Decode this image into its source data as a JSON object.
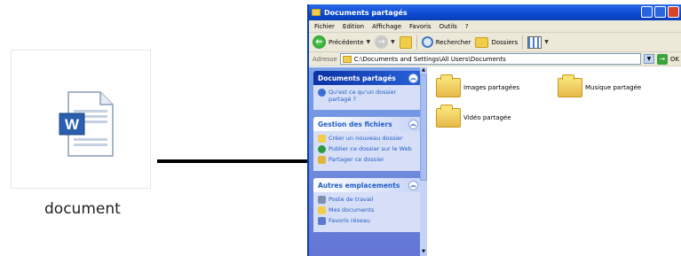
{
  "document_tile": {
    "label": "document",
    "icon": "word-document-icon"
  },
  "window": {
    "title": "Documents partagés",
    "title_icon": "folder-icon",
    "menu": [
      "Fichier",
      "Edition",
      "Affichage",
      "Favoris",
      "Outils",
      "?"
    ],
    "toolbar": {
      "back_label": "Précédente",
      "search_label": "Rechercher",
      "folders_label": "Dossiers"
    },
    "address": {
      "label": "Adresse",
      "value": "C:\\Documents and Settings\\All Users\\Documents",
      "go_label": "OK"
    },
    "taskpane": {
      "panel1": {
        "title": "Documents partagés",
        "items": [
          {
            "label": "Qu'est ce qu'un dossier partagé ?",
            "icon": "help-icon"
          }
        ]
      },
      "panel2": {
        "title": "Gestion des fichiers",
        "items": [
          {
            "label": "Créer un nouveau dossier",
            "icon": "new-folder-icon"
          },
          {
            "label": "Publier ce dossier sur le Web",
            "icon": "web-publish-icon"
          },
          {
            "label": "Partager ce dossier",
            "icon": "share-folder-icon"
          }
        ]
      },
      "panel3": {
        "title": "Autres emplacements",
        "items": [
          {
            "label": "Poste de travail",
            "icon": "computer-icon"
          },
          {
            "label": "Mes documents",
            "icon": "my-documents-icon"
          },
          {
            "label": "Favoris réseau",
            "icon": "network-places-icon"
          }
        ]
      }
    },
    "files": [
      {
        "label": "Images partagées",
        "icon": "shared-pictures-folder-icon"
      },
      {
        "label": "Musique partagée",
        "icon": "shared-music-folder-icon"
      },
      {
        "label": "Vidéo partagée",
        "icon": "shared-video-folder-icon"
      }
    ]
  },
  "colors": {
    "titlebar": "#0b4ad0",
    "taskpane": "#6375d6",
    "panel_head_dark": "#0c32a4",
    "link": "#215dc6"
  }
}
